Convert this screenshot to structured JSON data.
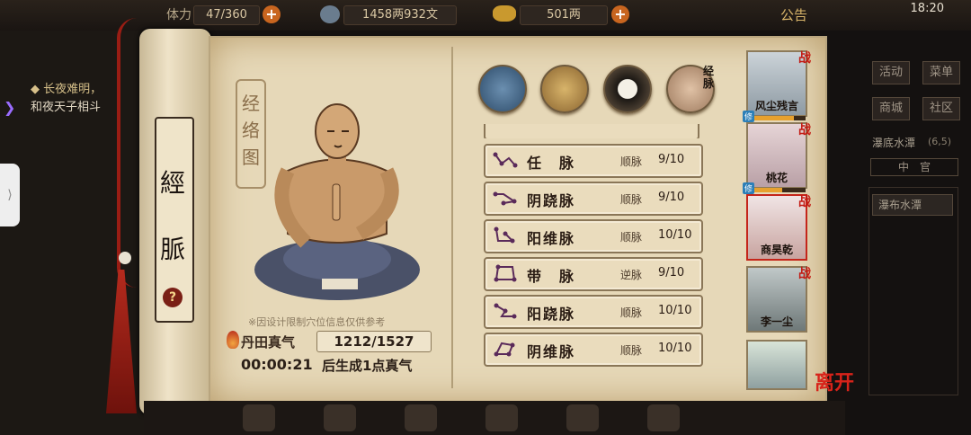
{
  "topbar": {
    "stamina": "47/360",
    "silver": "1458两932文",
    "gold": "501两",
    "announcement": "公告",
    "time": "18:20"
  },
  "left_panel": {
    "lines": [
      "◆ 长夜难明，",
      "和夜天子相斗"
    ]
  },
  "scroll": {
    "chars": [
      "經",
      "脈"
    ],
    "help": "?"
  },
  "meridian_chart": {
    "title": "经络图",
    "note": "※因设计限制穴位信息仅供参考",
    "qi_label": "丹田真气",
    "qi_value": "1212/1527",
    "timer": "00:00:21",
    "timer_suffix": "后生成1点真气"
  },
  "tabs": {
    "icons": [
      "hat-icon",
      "scroll-map-icon",
      "bagua-icon",
      "meridian-body-icon"
    ],
    "active_label": "经脉"
  },
  "meridians": [
    {
      "name": "任　脉",
      "type": "顺脉",
      "value": "9/10"
    },
    {
      "name": "阴跷脉",
      "type": "顺脉",
      "value": "9/10"
    },
    {
      "name": "阳维脉",
      "type": "顺脉",
      "value": "10/10"
    },
    {
      "name": "带　脉",
      "type": "逆脉",
      "value": "9/10"
    },
    {
      "name": "阳跷脉",
      "type": "顺脉",
      "value": "10/10"
    },
    {
      "name": "阴维脉",
      "type": "顺脉",
      "value": "10/10"
    }
  ],
  "characters": [
    {
      "name": "风尘残言",
      "war": "战",
      "xiu": "修"
    },
    {
      "name": "桃花",
      "war": "战",
      "xiu": "修"
    },
    {
      "name": "商昊乾",
      "war": "战"
    },
    {
      "name": "李一尘",
      "war": "战"
    },
    {
      "name": "",
      "war": ""
    }
  ],
  "right_menu": {
    "buttons": [
      "活动",
      "菜单",
      "商城",
      "社区"
    ],
    "location": "瀑底水潭",
    "coords": "(6,5)",
    "sub": "中　官",
    "place": "瀑布水潭"
  },
  "leave": "离开",
  "colors": {
    "accent_red": "#c31a12",
    "paper": "#e6d8b8",
    "orange": "#c8651f"
  }
}
